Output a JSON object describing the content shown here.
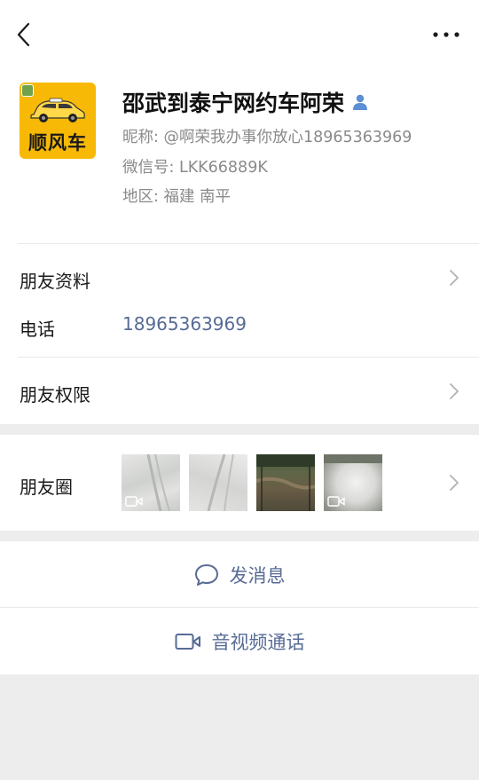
{
  "profile": {
    "name": "邵武到泰宁网约车阿荣",
    "nickname": "昵称: @啊荣我办事你放心18965363969",
    "wechat_id": "微信号: LKK66889K",
    "region": "地区: 福建  南平",
    "avatar_text": "顺风车"
  },
  "rows": {
    "friend_info": "朋友资料",
    "phone_label": "电话",
    "phone_value": "18965363969",
    "permissions": "朋友权限",
    "moments": "朋友圈"
  },
  "actions": {
    "message": "发消息",
    "video_call": "音视频通话"
  },
  "colors": {
    "link": "#576b95",
    "page_bg": "#ededed",
    "avatar_bg": "#f7b906"
  },
  "icons": [
    "back-arrow-icon",
    "more-dots-icon",
    "contact-person-icon",
    "chevron-right-icon",
    "chat-bubble-icon",
    "video-camera-icon"
  ]
}
